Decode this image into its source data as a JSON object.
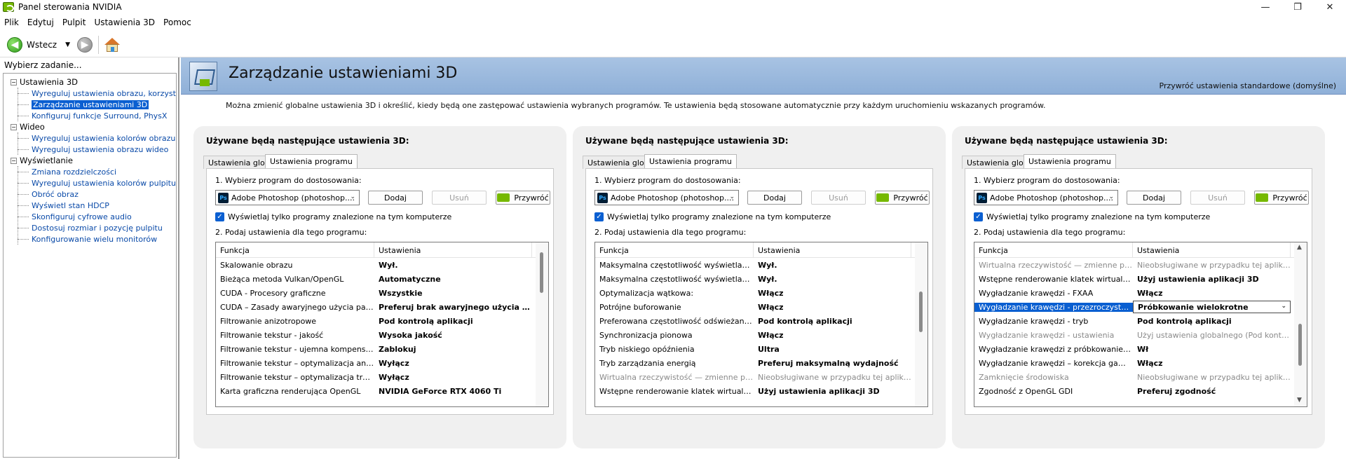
{
  "window": {
    "title": "Panel sterowania NVIDIA",
    "minimize": "—",
    "maximize": "❐",
    "close": "✕"
  },
  "menu": [
    "Plik",
    "Edytuj",
    "Pulpit",
    "Ustawienia 3D",
    "Pomoc"
  ],
  "toolbar": {
    "back_label": "Wstecz"
  },
  "sidebar": {
    "header": "Wybierz zadanie...",
    "groups": [
      {
        "label": "Ustawienia 3D",
        "items": [
          "Wyreguluj ustawienia obrazu, korzystając z podglądu",
          "Zarządzanie ustawieniami 3D",
          "Konfiguruj funkcje Surround, PhysX"
        ]
      },
      {
        "label": "Wideo",
        "items": [
          "Wyreguluj ustawienia kolorów obrazu wideo",
          "Wyreguluj ustawienia obrazu wideo"
        ]
      },
      {
        "label": "Wyświetlanie",
        "items": [
          "Zmiana rozdzielczości",
          "Wyreguluj ustawienia kolorów pulpitu",
          "Obróć obraz",
          "Wyświetl stan HDCP",
          "Skonfiguruj cyfrowe audio",
          "Dostosuj rozmiar i pozycję pulpitu",
          "Konfigurowanie wielu monitorów"
        ]
      }
    ],
    "selected": "Zarządzanie ustawieniami 3D"
  },
  "banner": {
    "title": "Zarządzanie ustawieniami 3D",
    "restore_link": "Przywróć ustawienia standardowe (domyślne)"
  },
  "description": "Można zmienić globalne ustawienia 3D i określić, kiedy będą one zastępować ustawienia wybranych programów. Te ustawienia będą stosowane automatycznie przy każdym uruchomieniu wskazanych programów.",
  "panel_common": {
    "heading": "Używane będą następujące ustawienia 3D:",
    "tab_global": "Ustawienia globalne",
    "tab_program": "Ustawienia programu",
    "step1": "1. Wybierz program do dostosowania:",
    "program_selected": "Adobe Photoshop (photoshop....",
    "ps_icon_text": "Ps",
    "btn_add": "Dodaj",
    "btn_remove": "Usuń",
    "btn_restore": "Przywróć",
    "checkbox_label": "Wyświetlaj tylko programy znalezione na tym komputerze",
    "checkbox_checked": true,
    "step2": "2. Podaj ustawienia dla tego programu:",
    "col_function": "Funkcja",
    "col_settings": "Ustawienia"
  },
  "panels": [
    {
      "rows": [
        {
          "f": "Skalowanie obrazu",
          "v": "Wył."
        },
        {
          "f": "Bieżąca metoda Vulkan/OpenGL",
          "v": "Automatyczne"
        },
        {
          "f": "CUDA - Procesory graficzne",
          "v": "Wszystkie"
        },
        {
          "f": "CUDA – Zasady awaryjnego użycia pamię...",
          "v": "Preferuj brak awaryjnego użycia pa..."
        },
        {
          "f": "Filtrowanie anizotropowe",
          "v": "Pod kontrolą aplikacji"
        },
        {
          "f": "Filtrowanie tekstur - jakość",
          "v": "Wysoka jakość"
        },
        {
          "f": "Filtrowanie tekstur - ujemna kompensacja...",
          "v": "Zablokuj"
        },
        {
          "f": "Filtrowanie tekstur – optymalizacja anizot...",
          "v": "Wyłącz"
        },
        {
          "f": "Filtrowanie tekstur – optymalizacja trójlini...",
          "v": "Wyłącz"
        },
        {
          "f": "Karta graficzna renderująca OpenGL",
          "v": "NVIDIA GeForce RTX 4060 Ti"
        }
      ]
    },
    {
      "rows": [
        {
          "f": "Maksymalna częstotliwość wyświetlania kl...",
          "v": "Wył."
        },
        {
          "f": "Maksymalna częstotliwość wyświetlania kl...",
          "v": "Wył."
        },
        {
          "f": "Optymalizacja wątkowa:",
          "v": "Włącz"
        },
        {
          "f": "Potrójne buforowanie",
          "v": "Włącz"
        },
        {
          "f": "Preferowana częstotliwość odświeżania (...",
          "v": "Pod kontrolą aplikacji"
        },
        {
          "f": "Synchronizacja pionowa",
          "v": "Włącz"
        },
        {
          "f": "Tryb niskiego opóźnienia",
          "v": "Ultra"
        },
        {
          "f": "Tryb zarządzania energią",
          "v": "Preferuj maksymalną wydajność"
        },
        {
          "f": "Wirtualna rzeczywistość — zmienne próbk...",
          "v": "Nieobsługiwane w przypadku tej aplikacji",
          "dim": true
        },
        {
          "f": "Wstępne renderowanie klatek wirtualnej r...",
          "v": "Użyj ustawienia aplikacji 3D"
        }
      ]
    },
    {
      "rows": [
        {
          "f": "Wirtualna rzeczywistość — zmienne próbk...",
          "v": "Nieobsługiwane w przypadku tej aplikacji",
          "dim": true
        },
        {
          "f": "Wstępne renderowanie klatek wirtualnej r...",
          "v": "Użyj ustawienia aplikacji 3D"
        },
        {
          "f": "Wygładzanie krawędzi - FXAA",
          "v": "Włącz"
        },
        {
          "f": "Wygładzanie krawędzi - przezroczystość",
          "v": "Próbkowanie wielokrotne",
          "selected": true
        },
        {
          "f": "Wygładzanie krawędzi - tryb",
          "v": "Pod kontrolą aplikacji"
        },
        {
          "f": "Wygładzanie krawędzi - ustawienia",
          "v": "Użyj ustawienia globalnego (Pod kontrolą ...",
          "dim": true
        },
        {
          "f": "Wygładzanie krawędzi z próbkowaniem wi...",
          "v": "Wł"
        },
        {
          "f": "Wygładzanie krawędzi – korekcja gamma",
          "v": "Włącz"
        },
        {
          "f": "Zamknięcie środowiska",
          "v": "Nieobsługiwane w przypadku tej aplikacji",
          "dim": true
        },
        {
          "f": "Zgodność z OpenGL GDI",
          "v": "Preferuj zgodność"
        }
      ]
    }
  ]
}
